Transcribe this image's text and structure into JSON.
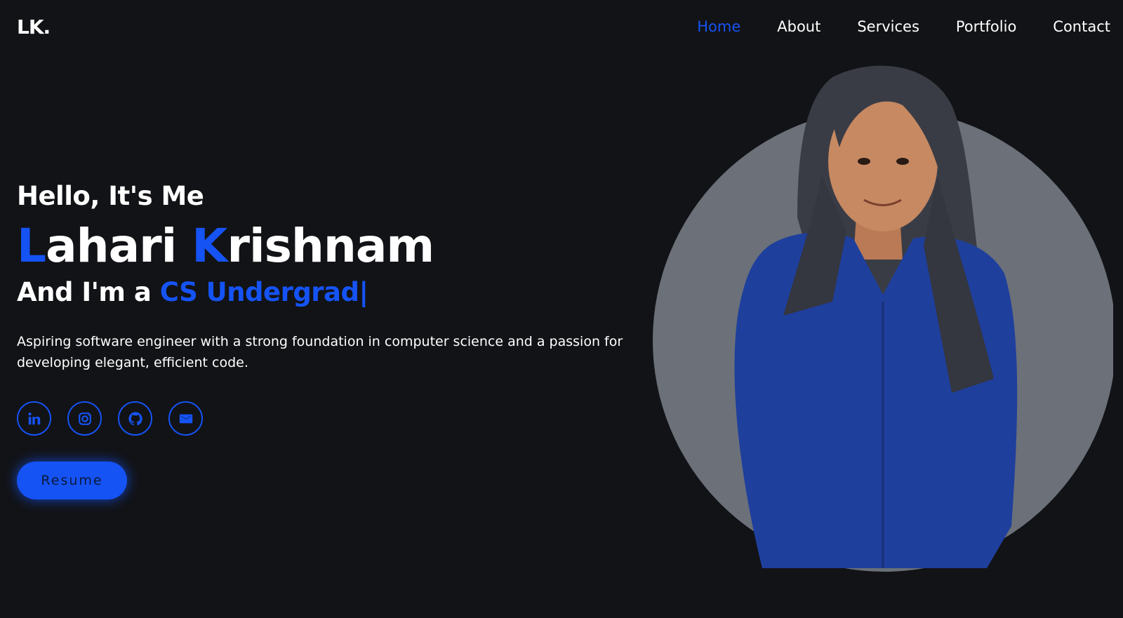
{
  "brand": {
    "logo": "LK."
  },
  "nav": {
    "items": [
      {
        "label": "Home",
        "active": true
      },
      {
        "label": "About"
      },
      {
        "label": "Services"
      },
      {
        "label": "Portfolio"
      },
      {
        "label": "Contact"
      }
    ]
  },
  "hero": {
    "greeting": "Hello, It's Me",
    "name_first_initial": "L",
    "name_first_rest": "ahari",
    "name_last_initial": "K",
    "name_last_rest": "rishnam",
    "role_prefix": "And I'm a",
    "role_typed": "CS Undergrad",
    "role_caret": "|",
    "description": "Aspiring software engineer with a strong foundation in computer science and a passion for developing elegant, efficient code.",
    "socials": [
      {
        "icon": "linkedin-icon"
      },
      {
        "icon": "instagram-icon"
      },
      {
        "icon": "github-icon"
      },
      {
        "icon": "mail-icon"
      }
    ],
    "resume_label": "Resume"
  },
  "colors": {
    "background": "#121316",
    "accent": "#1553f5",
    "text": "#ffffff",
    "portrait_circle": "#6b7079"
  }
}
